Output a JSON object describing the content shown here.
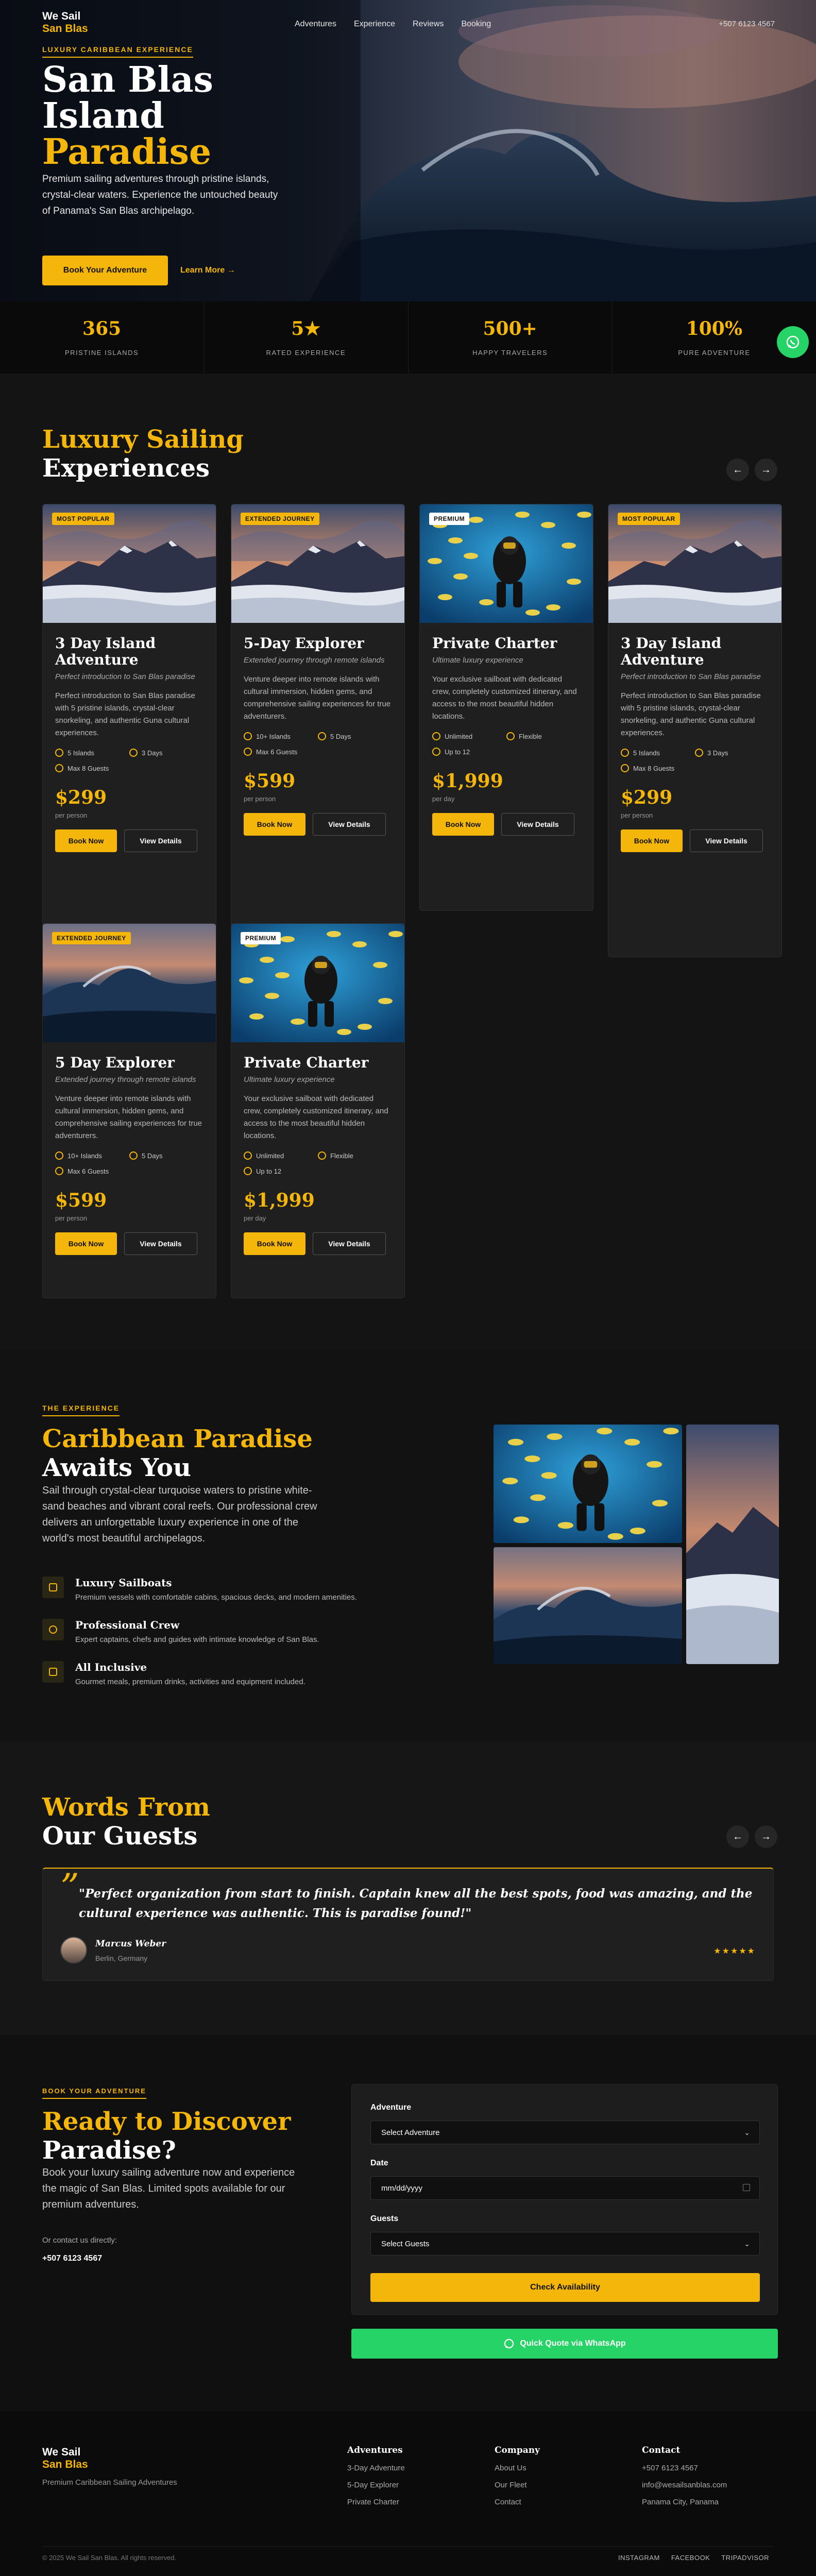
{
  "nav": {
    "logo_line1": "We Sail",
    "logo_line2": "San Blas",
    "links": [
      "Adventures",
      "Experience",
      "Reviews",
      "Booking"
    ],
    "phone": "+507 6123 4567"
  },
  "hero": {
    "kicker": "LUXURY CARIBBEAN EXPERIENCE",
    "title_line1": "San Blas",
    "title_line2": "Island",
    "title_line3": "Paradise",
    "description": "Premium sailing adventures through pristine islands, crystal-clear waters. Experience the untouched beauty of Panama's San Blas archipelago.",
    "cta_primary": "Book Your Adventure",
    "cta_secondary": "Learn More →"
  },
  "stats": [
    {
      "value": "365",
      "label": "PRISTINE ISLANDS"
    },
    {
      "value": "5★",
      "label": "RATED EXPERIENCE"
    },
    {
      "value": "500+",
      "label": "HAPPY TRAVELERS"
    },
    {
      "value": "100%",
      "label": "PURE ADVENTURE"
    }
  ],
  "experiences": {
    "title_line1": "Luxury Sailing",
    "title_line2": "Experiences",
    "prev": "←",
    "next": "→",
    "cards": [
      {
        "badge": "MOST POPULAR",
        "image": "mountain",
        "title": "3 Day Island Adventure",
        "subtitle": "Perfect introduction to San Blas paradise",
        "description": "Perfect introduction to San Blas paradise with 5 pristine islands, crystal-clear snorkeling, and authentic Guna cultural experiences.",
        "features": [
          "5 Islands",
          "3 Days",
          "Max 8 Guests"
        ],
        "price": "$299",
        "unit": "per person",
        "book": "Book Now",
        "details": "View Details"
      },
      {
        "badge": "EXTENDED JOURNEY",
        "image": "mountain",
        "title": "5-Day Explorer",
        "subtitle": "Extended journey through remote islands",
        "description": "Venture deeper into remote islands with cultural immersion, hidden gems, and comprehensive sailing experiences for true adventurers.",
        "features": [
          "10+ Islands",
          "5 Days",
          "Max 6 Guests"
        ],
        "price": "$599",
        "unit": "per person",
        "book": "Book Now",
        "details": "View Details"
      },
      {
        "badge": "PREMIUM",
        "image": "diver",
        "title": "Private Charter",
        "subtitle": "Ultimate luxury experience",
        "description": "Your exclusive sailboat with dedicated crew, completely customized itinerary, and access to the most beautiful hidden locations.",
        "features": [
          "Unlimited",
          "Flexible",
          "Up to 12"
        ],
        "price": "$1,999",
        "unit": "per day",
        "book": "Book Now",
        "details": "View Details"
      },
      {
        "badge": "MOST POPULAR",
        "image": "mountain",
        "title": "3 Day Island Adventure",
        "subtitle": "Perfect introduction to San Blas paradise",
        "description": "Perfect introduction to San Blas paradise with 5 pristine islands, crystal-clear snorkeling, and authentic Guna cultural experiences.",
        "features": [
          "5 Islands",
          "3 Days",
          "Max 8 Guests"
        ],
        "price": "$299",
        "unit": "per person",
        "book": "Book Now",
        "details": "View Details"
      },
      {
        "badge": "EXTENDED JOURNEY",
        "image": "wave",
        "title": "5 Day Explorer",
        "subtitle": "Extended journey through remote islands",
        "description": "Venture deeper into remote islands with cultural immersion, hidden gems, and comprehensive sailing experiences for true adventurers.",
        "features": [
          "10+ Islands",
          "5 Days",
          "Max 6 Guests"
        ],
        "price": "$599",
        "unit": "per person",
        "book": "Book Now",
        "details": "View Details"
      },
      {
        "badge": "PREMIUM",
        "image": "diver",
        "title": "Private Charter",
        "subtitle": "Ultimate luxury experience",
        "description": "Your exclusive sailboat with dedicated crew, completely customized itinerary, and access to the most beautiful hidden locations.",
        "features": [
          "Unlimited",
          "Flexible",
          "Up to 12"
        ],
        "price": "$1,999",
        "unit": "per day",
        "book": "Book Now",
        "details": "View Details"
      }
    ]
  },
  "paradise": {
    "kicker": "THE EXPERIENCE",
    "title_line1": "Caribbean Paradise",
    "title_line2": "Awaits You",
    "description": "Sail through crystal-clear turquoise waters to pristine white-sand beaches and vibrant coral reefs. Our professional crew delivers an unforgettable luxury experience in one of the world's most beautiful archipelagos.",
    "items": [
      {
        "title": "Luxury Sailboats",
        "text": "Premium vessels with comfortable cabins, spacious decks, and modern amenities."
      },
      {
        "title": "Professional Crew",
        "text": "Expert captains, chefs and guides with intimate knowledge of San Blas."
      },
      {
        "title": "All Inclusive",
        "text": "Gourmet meals, premium drinks, activities and equipment included."
      }
    ]
  },
  "reviews": {
    "title_line1": "Words From",
    "title_line2": "Our Guests",
    "prev": "←",
    "next": "→",
    "quote_mark": "”",
    "quote": "\"Perfect organization from start to finish. Captain knew all the best spots, food was amazing, and the cultural experience was authentic. This is paradise found!\"",
    "name": "Marcus Weber",
    "location": "Berlin, Germany",
    "stars": "★★★★★"
  },
  "booking": {
    "kicker": "BOOK YOUR ADVENTURE",
    "title_line1": "Ready to Discover",
    "title_line2": "Paradise?",
    "description": "Book your luxury sailing adventure now and experience the magic of San Blas. Limited spots available for our premium adventures.",
    "contact_label": "Or contact us directly:",
    "contact_phone": "+507 6123 4567",
    "adventure_label": "Adventure",
    "adventure_value": "Select Adventure",
    "date_label": "Date",
    "date_placeholder": "mm/dd/yyyy",
    "guests_label": "Guests",
    "guests_value": "Select Guests",
    "submit": "Check Availability",
    "whatsapp": "Quick Quote via WhatsApp"
  },
  "footer": {
    "logo_line1": "We Sail",
    "logo_line2": "San Blas",
    "tagline": "Premium Caribbean Sailing Adventures",
    "adventures_h": "Adventures",
    "adventures": [
      "3-Day Adventure",
      "5-Day Explorer",
      "Private Charter"
    ],
    "company_h": "Company",
    "company": [
      "About Us",
      "Our Fleet",
      "Contact"
    ],
    "contact_h": "Contact",
    "contact": [
      "+507 6123 4567",
      "info@wesailsanblas.com",
      "Panama City, Panama"
    ],
    "copyright": "© 2025 We Sail San Blas. All rights reserved.",
    "social": [
      "INSTAGRAM",
      "FACEBOOK",
      "TRIPADVISOR"
    ]
  },
  "colors": {
    "accent": "#F5B60B",
    "whatsapp": "#25D366",
    "background": "#141414"
  }
}
